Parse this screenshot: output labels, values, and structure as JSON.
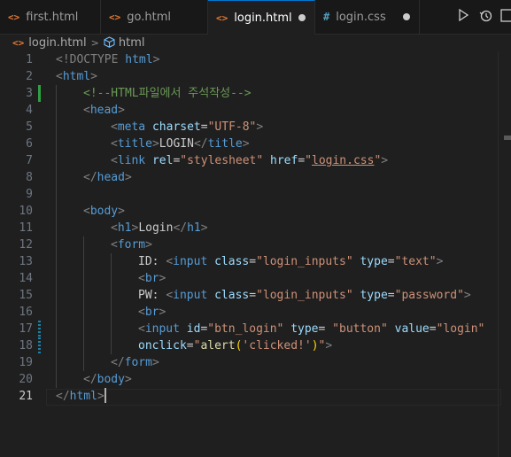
{
  "tabs": [
    {
      "label": "first.html",
      "icon": "html-file-icon",
      "active": false,
      "dirty": false
    },
    {
      "label": "go.html",
      "icon": "html-file-icon",
      "active": false,
      "dirty": false
    },
    {
      "label": "login.html",
      "icon": "html-file-icon",
      "active": true,
      "dirty": true
    },
    {
      "label": "login.css",
      "icon": "css-file-icon",
      "active": false,
      "dirty": true
    }
  ],
  "breadcrumb": {
    "file": "login.html",
    "symbol": "html"
  },
  "editor": {
    "line_numbers": [
      "1",
      "2",
      "3",
      "4",
      "5",
      "6",
      "7",
      "8",
      "9",
      "10",
      "11",
      "12",
      "13",
      "14",
      "15",
      "16",
      "17",
      "18",
      "19",
      "20",
      "21"
    ],
    "current_line": "21",
    "tokens": {
      "l1": [
        "<!DOCTYPE ",
        "html",
        ">"
      ],
      "l2": [
        "<",
        "html",
        ">"
      ],
      "l3": [
        "<!--HTML파일에서 주석작성-->"
      ],
      "l4": [
        "<",
        "head",
        ">"
      ],
      "l5": [
        "<",
        "meta",
        " ",
        "charset",
        "=",
        "\"UTF-8\"",
        ">"
      ],
      "l6": [
        "<",
        "title",
        ">",
        "LOGIN",
        "</",
        "title",
        ">"
      ],
      "l7": [
        "<",
        "link",
        " ",
        "rel",
        "=",
        "\"stylesheet\"",
        " ",
        "href",
        "=",
        "\"",
        "login.css",
        "\"",
        ">"
      ],
      "l8": [
        "</",
        "head",
        ">"
      ],
      "l10": [
        "<",
        "body",
        ">"
      ],
      "l11": [
        "<",
        "h1",
        ">",
        "Login",
        "</",
        "h1",
        ">"
      ],
      "l12": [
        "<",
        "form",
        ">"
      ],
      "l13": [
        "ID: ",
        "<",
        "input",
        " ",
        "class",
        "=",
        "\"login_inputs\"",
        " ",
        "type",
        "=",
        "\"text\"",
        ">"
      ],
      "l14": [
        "<",
        "br",
        ">"
      ],
      "l15": [
        "PW: ",
        "<",
        "input",
        " ",
        "class",
        "=",
        "\"login_inputs\"",
        " ",
        "type",
        "=",
        "\"password\"",
        ">"
      ],
      "l16": [
        "<",
        "br",
        ">"
      ],
      "l17": [
        "<",
        "input",
        " ",
        "id",
        "=",
        "\"btn_login\"",
        " ",
        "type",
        "= ",
        "\"button\"",
        " ",
        "value",
        "=",
        "\"login\""
      ],
      "l18": [
        "onclick",
        "=",
        "\"",
        "alert",
        "(",
        "'clicked!'",
        ")",
        "\"",
        ">"
      ],
      "l19": [
        "</",
        "form",
        ">"
      ],
      "l20": [
        "</",
        "body",
        ">"
      ],
      "l21": [
        "</",
        "html",
        ">"
      ]
    }
  },
  "colors": {
    "tag": "#569cd6",
    "attribute": "#9cdcfe",
    "string": "#ce9178",
    "comment": "#6a9955",
    "function": "#dcdcaa",
    "accent": "#0078d4"
  }
}
